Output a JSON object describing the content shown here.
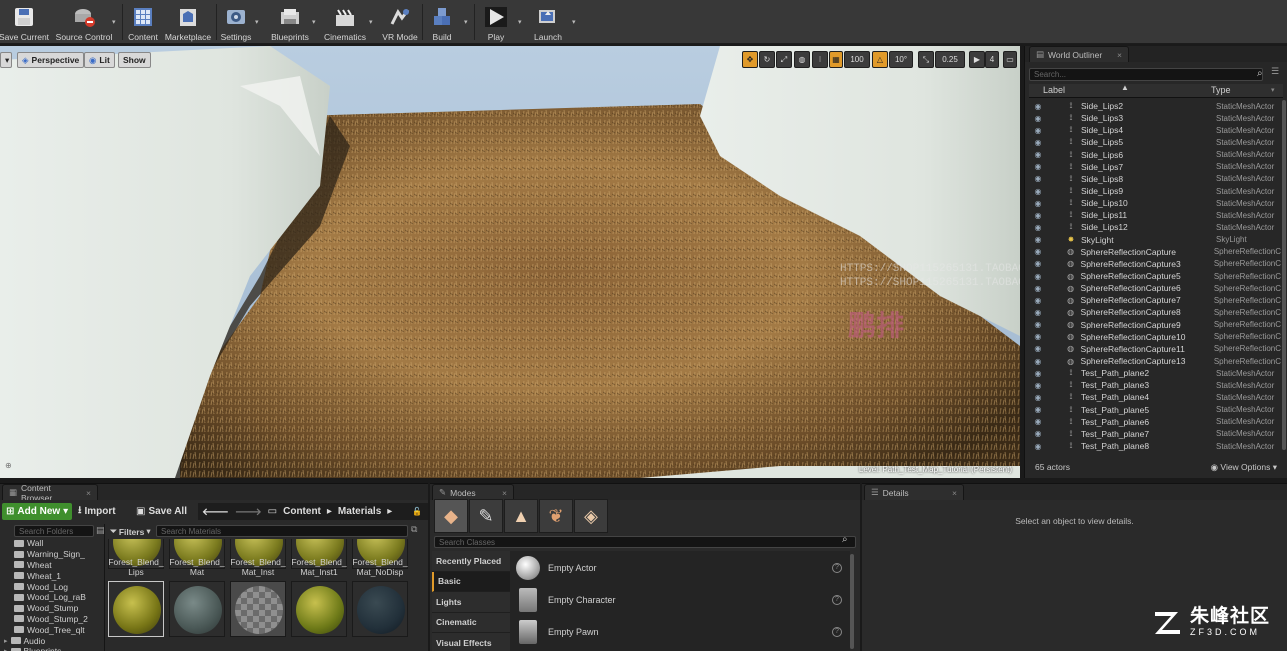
{
  "toolbar": {
    "items": [
      {
        "label": "Save Current"
      },
      {
        "label": "Source Control"
      },
      {
        "label": "Content"
      },
      {
        "label": "Marketplace"
      },
      {
        "label": "Settings"
      },
      {
        "label": "Blueprints"
      },
      {
        "label": "Cinematics"
      },
      {
        "label": "VR Mode"
      },
      {
        "label": "Build"
      },
      {
        "label": "Play"
      },
      {
        "label": "Launch"
      }
    ]
  },
  "viewport": {
    "perspective_label": "Perspective",
    "lit_label": "Lit",
    "show_label": "Show",
    "grid_snap": "100",
    "rotation_snap": "10°",
    "scale_snap": "0.25",
    "camera_speed": "4",
    "level_text": "Level:  Path_Test_Map_Tutorial (Persistent)",
    "watermark_line1": "HTTPS://SHOP115265131.TAOBAO.C",
    "watermark_line2": "HTTPS://SHOP115265131.TAOBAO.C",
    "watermark_cn": "鹏排"
  },
  "outliner": {
    "tab_label": "World Outliner",
    "search_placeholder": "Search...",
    "col_label": "Label",
    "col_type": "Type",
    "rows": [
      {
        "label": "Side_Lips2",
        "type": "StaticMeshActor",
        "icon": "mesh"
      },
      {
        "label": "Side_Lips3",
        "type": "StaticMeshActor",
        "icon": "mesh"
      },
      {
        "label": "Side_Lips4",
        "type": "StaticMeshActor",
        "icon": "mesh"
      },
      {
        "label": "Side_Lips5",
        "type": "StaticMeshActor",
        "icon": "mesh"
      },
      {
        "label": "Side_Lips6",
        "type": "StaticMeshActor",
        "icon": "mesh"
      },
      {
        "label": "Side_Lips7",
        "type": "StaticMeshActor",
        "icon": "mesh"
      },
      {
        "label": "Side_Lips8",
        "type": "StaticMeshActor",
        "icon": "mesh"
      },
      {
        "label": "Side_Lips9",
        "type": "StaticMeshActor",
        "icon": "mesh"
      },
      {
        "label": "Side_Lips10",
        "type": "StaticMeshActor",
        "icon": "mesh"
      },
      {
        "label": "Side_Lips11",
        "type": "StaticMeshActor",
        "icon": "mesh"
      },
      {
        "label": "Side_Lips12",
        "type": "StaticMeshActor",
        "icon": "mesh"
      },
      {
        "label": "SkyLight",
        "type": "SkyLight",
        "icon": "light"
      },
      {
        "label": "SphereReflectionCapture",
        "type": "SphereReflectionC",
        "icon": "sphere"
      },
      {
        "label": "SphereReflectionCapture3",
        "type": "SphereReflectionC",
        "icon": "sphere"
      },
      {
        "label": "SphereReflectionCapture5",
        "type": "SphereReflectionC",
        "icon": "sphere"
      },
      {
        "label": "SphereReflectionCapture6",
        "type": "SphereReflectionC",
        "icon": "sphere"
      },
      {
        "label": "SphereReflectionCapture7",
        "type": "SphereReflectionC",
        "icon": "sphere"
      },
      {
        "label": "SphereReflectionCapture8",
        "type": "SphereReflectionC",
        "icon": "sphere"
      },
      {
        "label": "SphereReflectionCapture9",
        "type": "SphereReflectionC",
        "icon": "sphere"
      },
      {
        "label": "SphereReflectionCapture10",
        "type": "SphereReflectionC",
        "icon": "sphere"
      },
      {
        "label": "SphereReflectionCapture11",
        "type": "SphereReflectionC",
        "icon": "sphere"
      },
      {
        "label": "SphereReflectionCapture13",
        "type": "SphereReflectionC",
        "icon": "sphere"
      },
      {
        "label": "Test_Path_plane2",
        "type": "StaticMeshActor",
        "icon": "mesh"
      },
      {
        "label": "Test_Path_plane3",
        "type": "StaticMeshActor",
        "icon": "mesh"
      },
      {
        "label": "Test_Path_plane4",
        "type": "StaticMeshActor",
        "icon": "mesh"
      },
      {
        "label": "Test_Path_plane5",
        "type": "StaticMeshActor",
        "icon": "mesh"
      },
      {
        "label": "Test_Path_plane6",
        "type": "StaticMeshActor",
        "icon": "mesh"
      },
      {
        "label": "Test_Path_plane7",
        "type": "StaticMeshActor",
        "icon": "mesh"
      },
      {
        "label": "Test_Path_plane8",
        "type": "StaticMeshActor",
        "icon": "mesh"
      }
    ],
    "actor_count": "65 actors",
    "view_options": "View Options"
  },
  "content_browser": {
    "tab_label": "Content Browser",
    "add_new": "Add New",
    "import": "Import",
    "save_all": "Save All",
    "path": [
      "Content",
      "Materials"
    ],
    "folder_search_placeholder": "Search Folders",
    "filters_label": "Filters",
    "asset_search_placeholder": "Search Materials",
    "folders": [
      "Wall",
      "Warning_Sign_",
      "Wheat",
      "Wheat_1",
      "Wood_Log",
      "Wood_Log_raB",
      "Wood_Stump",
      "Wood_Stump_2",
      "Wood_Tree_qlt",
      "Audio",
      "Blueprints"
    ],
    "assets_row1": [
      {
        "label": "Forest_Blend_ Lips"
      },
      {
        "label": "Forest_Blend_ Mat"
      },
      {
        "label": "Forest_Blend_ Mat_Inst"
      },
      {
        "label": "Forest_Blend_ Mat_Inst1"
      },
      {
        "label": "Forest_Blend_ Mat_NoDisp"
      }
    ]
  },
  "modes": {
    "tab_label": "Modes",
    "search_placeholder": "Search Classes",
    "categories": [
      "Recently Placed",
      "Basic",
      "Lights",
      "Cinematic",
      "Visual Effects"
    ],
    "selected_category": "Basic",
    "items": [
      {
        "label": "Empty Actor"
      },
      {
        "label": "Empty Character"
      },
      {
        "label": "Empty Pawn"
      }
    ]
  },
  "details": {
    "tab_label": "Details",
    "empty_message": "Select an object to view details."
  },
  "site_watermark": {
    "cn": "朱峰社区",
    "en": "ZF3D.COM"
  }
}
